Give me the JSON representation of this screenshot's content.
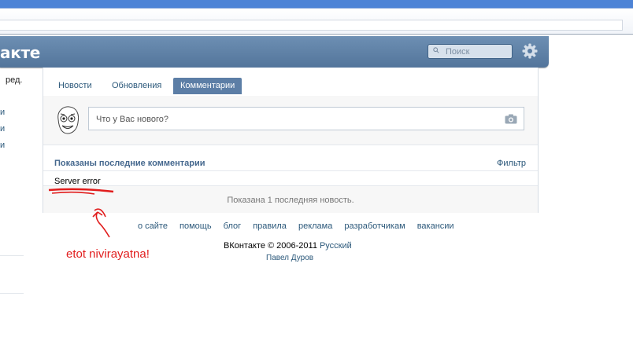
{
  "header": {
    "logo_text": "акте",
    "search_placeholder": "Поиск"
  },
  "left_column": {
    "edit_text": "ред.",
    "items": [
      "и",
      "и",
      "и"
    ]
  },
  "tabs": [
    {
      "label": "Новости",
      "active": false
    },
    {
      "label": "Обновления",
      "active": false
    },
    {
      "label": "Комментарии",
      "active": true
    }
  ],
  "composer": {
    "placeholder": "Что у Вас нового?"
  },
  "feed": {
    "section_title": "Показаны последние комментарии",
    "filter_label": "Фильтр",
    "error_text": "Server error",
    "news_count_text": "Показана 1 последняя новость."
  },
  "footer": {
    "links": [
      "о сайте",
      "помощь",
      "блог",
      "правила",
      "реклама",
      "разработчикам",
      "вакансии"
    ],
    "copyright": "ВКонтакте © 2006-2011",
    "language": "Русский",
    "author": "Павел Дуров"
  },
  "annotation": {
    "text": "etot nivirayatna!"
  },
  "colors": {
    "header_blue": "#5a7ca1",
    "link": "#2b587a",
    "active_tab": "#5c7ea6",
    "annotation_red": "#e11d1d"
  }
}
